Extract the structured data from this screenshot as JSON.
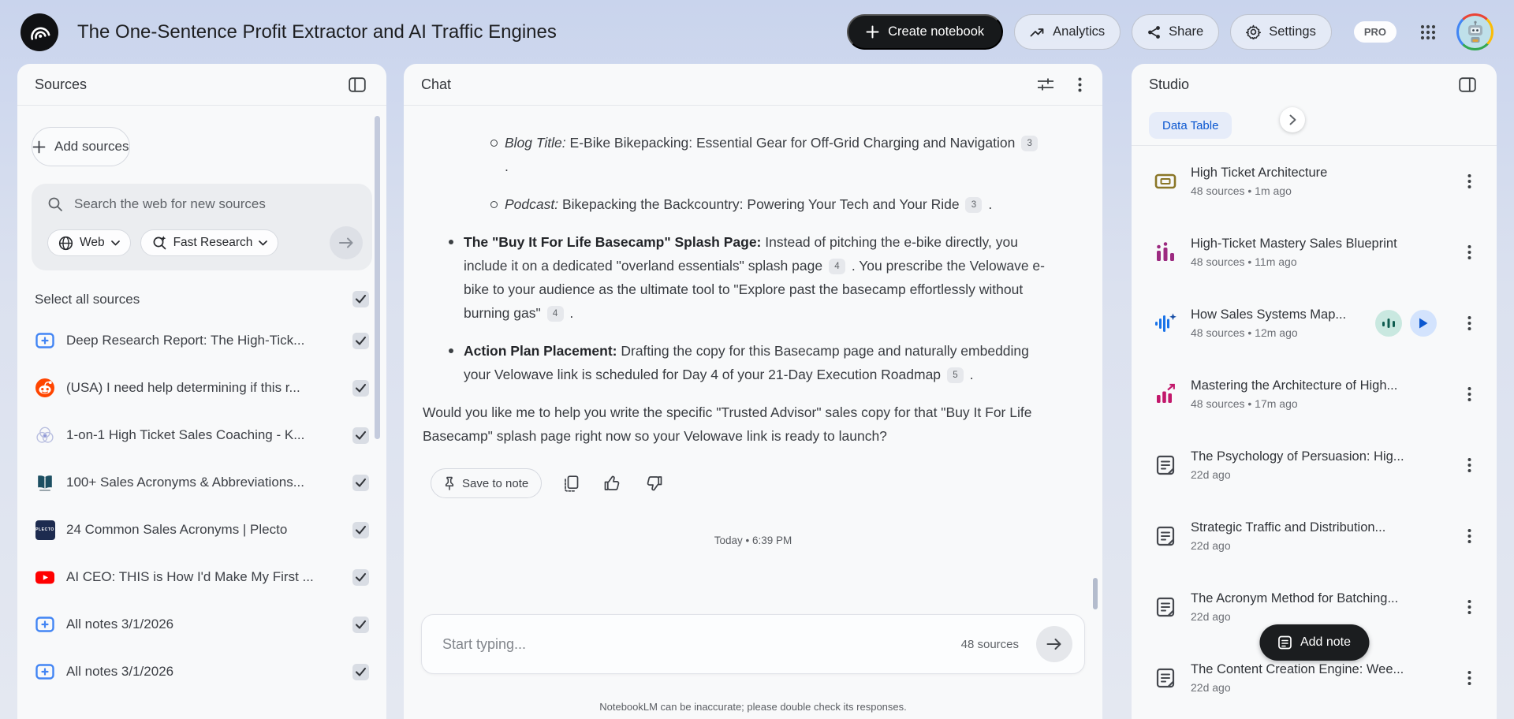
{
  "header": {
    "title": "The One-Sentence Profit Extractor and AI Traffic Engines",
    "create_notebook_label": "Create notebook",
    "analytics_label": "Analytics",
    "share_label": "Share",
    "settings_label": "Settings",
    "pro_badge": "PRO"
  },
  "sources": {
    "title": "Sources",
    "add_button_label": "Add sources",
    "search_placeholder": "Search the web for new sources",
    "web_chip_label": "Web",
    "research_chip_label": "Fast Research",
    "select_all_label": "Select all sources",
    "items": [
      {
        "icon": "notebooklm-note",
        "title": "Deep Research Report: The High-Tick...",
        "checked": true
      },
      {
        "icon": "reddit",
        "title": "(USA) I need help determining if this r...",
        "checked": true
      },
      {
        "icon": "venn",
        "title": "1-on-1 High Ticket Sales Coaching - K...",
        "checked": true
      },
      {
        "icon": "book",
        "title": "100+ Sales Acronyms & Abbreviations...",
        "checked": true
      },
      {
        "icon": "plecto",
        "icon_label": "PLECTO",
        "title": "24 Common Sales Acronyms | Plecto",
        "checked": true
      },
      {
        "icon": "youtube",
        "title": "AI CEO: THIS is How I'd Make My First ...",
        "checked": true
      },
      {
        "icon": "notebooklm-note",
        "title": "All notes 3/1/2026",
        "checked": true
      },
      {
        "icon": "notebooklm-note",
        "title": "All notes 3/1/2026",
        "checked": true
      }
    ]
  },
  "chat": {
    "title": "Chat",
    "blocks": [
      {
        "style": "sub",
        "segments": [
          {
            "text": "Blog Title:",
            "italic": true
          },
          {
            "text": " E-Bike Bikepacking: Essential Gear for Off-Grid Charging and Navigation "
          },
          {
            "cite": "3"
          },
          {
            "text": " ."
          }
        ]
      },
      {
        "style": "sub",
        "segments": [
          {
            "text": "Podcast:",
            "italic": true
          },
          {
            "text": " Bikepacking the Backcountry: Powering Your Tech and Your Ride "
          },
          {
            "cite": "3"
          },
          {
            "text": " ."
          }
        ]
      },
      {
        "style": "main",
        "segments": [
          {
            "text": "The \"Buy It For Life Basecamp\" Splash Page:",
            "bold": true
          },
          {
            "text": " Instead of pitching the e-bike directly, you include it on a dedicated \"overland essentials\" splash page "
          },
          {
            "cite": "4"
          },
          {
            "text": " . You prescribe the Velowave e-bike to your audience as the ultimate tool to \"Explore past the basecamp effortlessly without burning gas\" "
          },
          {
            "cite": "4"
          },
          {
            "text": " ."
          }
        ]
      },
      {
        "style": "main",
        "segments": [
          {
            "text": "Action Plan Placement:",
            "bold": true
          },
          {
            "text": " Drafting the copy for this Basecamp page and naturally embedding your Velowave link is scheduled for Day 4 of your 21-Day Execution Roadmap "
          },
          {
            "cite": "5"
          },
          {
            "text": " ."
          }
        ]
      },
      {
        "style": "plain",
        "segments": [
          {
            "text": "Would you like me to help you write the specific \"Trusted Advisor\" sales copy for that \"Buy It For Life Basecamp\" splash page right now so your Velowave link is ready to launch?"
          }
        ]
      }
    ],
    "save_to_note_label": "Save to note",
    "timestamp": "Today • 6:39 PM",
    "input_placeholder": "Start typing...",
    "sources_count": "48 sources",
    "disclaimer": "NotebookLM can be inaccurate; please double check its responses."
  },
  "studio": {
    "title": "Studio",
    "data_table_chip": "Data Table",
    "items": [
      {
        "icon": "flashcards",
        "title": "High Ticket Architecture",
        "meta": "48 sources • 1m ago"
      },
      {
        "icon": "report",
        "title": "High-Ticket Mastery Sales Blueprint",
        "meta": "48 sources • 11m ago"
      },
      {
        "icon": "audio",
        "title": "How Sales Systems Map...",
        "meta": "48 sources • 12m ago",
        "actions": [
          "interactive",
          "play"
        ]
      },
      {
        "icon": "chart-pink",
        "title": "Mastering the Architecture of High...",
        "meta": "48 sources • 17m ago"
      },
      {
        "icon": "note",
        "title": "The Psychology of Persuasion: Hig...",
        "meta": "22d ago"
      },
      {
        "icon": "note",
        "title": "Strategic Traffic and Distribution...",
        "meta": "22d ago"
      },
      {
        "icon": "note",
        "title": "The Acronym Method for Batching...",
        "meta": "22d ago"
      },
      {
        "icon": "note",
        "title": "The Content Creation Engine: Wee...",
        "meta": "22d ago"
      }
    ],
    "add_note_label": "Add note"
  },
  "colors": {
    "accent_blue": "#0b57d0",
    "source_note_blue": "#4285f4",
    "reddit_orange": "#ff4500",
    "youtube_red": "#ff0000",
    "book_teal": "#1d4f62",
    "plecto_navy": "#1d2b4f",
    "flashcards_gold": "#8a7627",
    "report_magenta": "#9c2a80",
    "audio_blue": "#1a73e8",
    "chart_pink": "#c2186b"
  }
}
